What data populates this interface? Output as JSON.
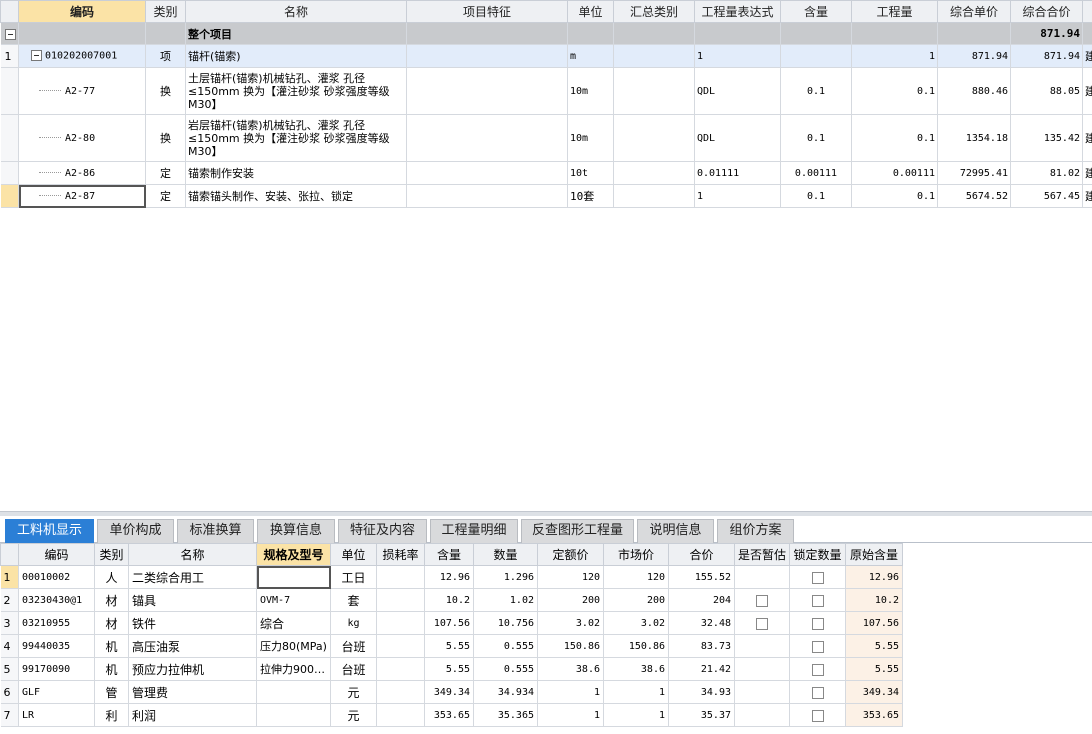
{
  "top_grid": {
    "headers": [
      "编码",
      "类别",
      "名称",
      "项目特征",
      "单位",
      "汇总类别",
      "工程量表达式",
      "含量",
      "工程量",
      "综合单价",
      "综合合价"
    ],
    "root": {
      "name": "整个项目",
      "total": "871.94"
    },
    "rows": [
      {
        "num": "1",
        "code": "010202007001",
        "type": "项",
        "name": "锚杆(锚索)",
        "unit": "m",
        "expr": "1",
        "content": "",
        "qty": "1",
        "unit_price": "871.94",
        "total": "871.94",
        "tail": "建"
      },
      {
        "num": "",
        "code": "A2-77",
        "type": "换",
        "name": "土层锚杆(锚索)机械钻孔、灌浆 孔径≤150mm  换为【灌注砂浆 砂浆强度等级M30】",
        "unit": "10m",
        "expr": "QDL",
        "content": "0.1",
        "qty": "0.1",
        "unit_price": "880.46",
        "total": "88.05",
        "tail": "建"
      },
      {
        "num": "",
        "code": "A2-80",
        "type": "换",
        "name": "岩层锚杆(锚索)机械钻孔、灌浆 孔径≤150mm  换为【灌注砂浆 砂浆强度等级M30】",
        "unit": "10m",
        "expr": "QDL",
        "content": "0.1",
        "qty": "0.1",
        "unit_price": "1354.18",
        "total": "135.42",
        "tail": "建"
      },
      {
        "num": "",
        "code": "A2-86",
        "type": "定",
        "name": "锚索制作安装",
        "unit": "10t",
        "expr": "0.01111",
        "content": "0.00111",
        "qty": "0.00111",
        "unit_price": "72995.41",
        "total": "81.02",
        "tail": "建"
      },
      {
        "num": "",
        "code": "A2-87",
        "type": "定",
        "name": "锚索锚头制作、安装、张拉、锁定",
        "unit": "10套",
        "expr": "1",
        "content": "0.1",
        "qty": "0.1",
        "unit_price": "5674.52",
        "total": "567.45",
        "tail": "建"
      }
    ]
  },
  "tabs": [
    "工料机显示",
    "单价构成",
    "标准换算",
    "换算信息",
    "特征及内容",
    "工程量明细",
    "反查图形工程量",
    "说明信息",
    "组价方案"
  ],
  "bottom_grid": {
    "headers": [
      "编码",
      "类别",
      "名称",
      "规格及型号",
      "单位",
      "损耗率",
      "含量",
      "数量",
      "定额价",
      "市场价",
      "合价",
      "是否暂估",
      "锁定数量",
      "原始含量"
    ],
    "rows": [
      {
        "num": "1",
        "code": "00010002",
        "type": "人",
        "name": "二类综合用工",
        "spec": "",
        "unit": "工日",
        "loss": "",
        "content": "12.96",
        "qty": "1.296",
        "quota": "120",
        "market": "120",
        "total": "155.52",
        "est": false,
        "lock": true,
        "orig": "12.96"
      },
      {
        "num": "2",
        "code": "03230430@1",
        "type": "材",
        "name": "锚具",
        "spec": "OVM-7",
        "unit": "套",
        "loss": "",
        "content": "10.2",
        "qty": "1.02",
        "quota": "200",
        "market": "200",
        "total": "204",
        "est": true,
        "lock": true,
        "orig": "10.2"
      },
      {
        "num": "3",
        "code": "03210955",
        "type": "材",
        "name": "铁件",
        "spec": "综合",
        "unit": "kg",
        "loss": "",
        "content": "107.56",
        "qty": "10.756",
        "quota": "3.02",
        "market": "3.02",
        "total": "32.48",
        "est": true,
        "lock": true,
        "orig": "107.56"
      },
      {
        "num": "4",
        "code": "99440035",
        "type": "机",
        "name": "高压油泵",
        "spec": "压力80(MPa)",
        "unit": "台班",
        "loss": "",
        "content": "5.55",
        "qty": "0.555",
        "quota": "150.86",
        "market": "150.86",
        "total": "83.73",
        "est": false,
        "lock": true,
        "orig": "5.55"
      },
      {
        "num": "5",
        "code": "99170090",
        "type": "机",
        "name": "预应力拉伸机",
        "spec": "拉伸力900…",
        "unit": "台班",
        "loss": "",
        "content": "5.55",
        "qty": "0.555",
        "quota": "38.6",
        "market": "38.6",
        "total": "21.42",
        "est": false,
        "lock": true,
        "orig": "5.55"
      },
      {
        "num": "6",
        "code": "GLF",
        "type": "管",
        "name": "管理费",
        "spec": "",
        "unit": "元",
        "loss": "",
        "content": "349.34",
        "qty": "34.934",
        "quota": "1",
        "market": "1",
        "total": "34.93",
        "est": false,
        "lock": true,
        "orig": "349.34"
      },
      {
        "num": "7",
        "code": "LR",
        "type": "利",
        "name": "利润",
        "spec": "",
        "unit": "元",
        "loss": "",
        "content": "353.65",
        "qty": "35.365",
        "quota": "1",
        "market": "1",
        "total": "35.37",
        "est": false,
        "lock": true,
        "orig": "353.65"
      }
    ]
  },
  "colors": {
    "active_tab": "#2b7fd6",
    "active_header": "#fbe3a6",
    "selected_row": "#e2ecfa",
    "root_row": "#c8cacd"
  }
}
